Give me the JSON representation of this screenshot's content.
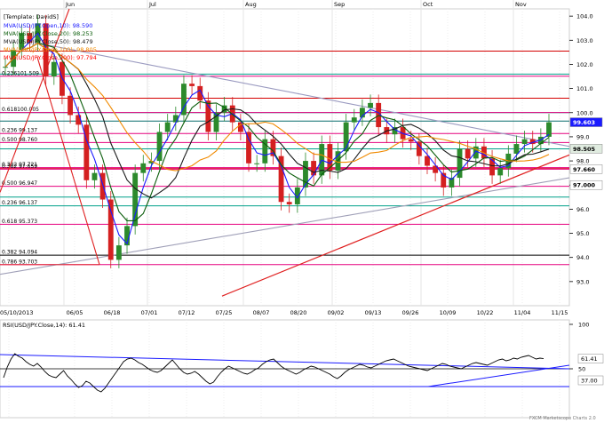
{
  "chart_data": {
    "type": "line",
    "title": "[Template: DavidS]",
    "instrument": "USD/JPY",
    "months": [
      "Jun",
      "Jul",
      "Aug",
      "Sep",
      "Oct",
      "Nov"
    ],
    "legend": [
      {
        "text": "MVA(USD/JPY.Open,10): 98.590",
        "color": "#1a1aff"
      },
      {
        "text": "MVA(USD/JPY.Close,20): 98.253",
        "color": "#0b5d0b"
      },
      {
        "text": "MVA(USD/JPY.Close,50): 98.479",
        "color": "#1a1a1a"
      },
      {
        "text": "MVA(USD/JPY.Close,100): 98.805",
        "color": "#f08a00"
      },
      {
        "text": "MVA(USD/JPY.Close,200): 97.794",
        "color": "#ff0000"
      }
    ],
    "x_tick_labels": [
      "05/10/2013",
      "06/05",
      "06/18",
      "07/01",
      "07/12",
      "07/25",
      "08/07",
      "08/20",
      "09/02",
      "09/13",
      "09/26",
      "10/09",
      "10/22",
      "11/04",
      "11/15"
    ],
    "y_axis": {
      "ylim": [
        92.0,
        104.3
      ],
      "ticks": [
        104.0,
        103.0,
        102.0,
        101.0,
        100.0,
        99.0,
        98.0,
        97.0,
        96.0,
        95.0,
        94.0,
        93.0
      ]
    },
    "price_boxes": [
      {
        "label": "99.603",
        "value": 99.603,
        "bg": "#1a1aff",
        "fg": "#ffffff"
      },
      {
        "label": "98.505",
        "value": 98.505,
        "bg": "#e0ece0",
        "fg": "#000000"
      },
      {
        "label": "97.660",
        "value": 97.66,
        "bg": "#ffffff",
        "fg": "#000000"
      },
      {
        "label": "97.000",
        "value": 97.0,
        "bg": "#ffffff",
        "fg": "#000000"
      }
    ],
    "fib_levels": [
      {
        "label": "0.236101.509",
        "value": 101.509,
        "color": "#e6007e"
      },
      {
        "label": "0.618100.005",
        "value": 100.005,
        "color": "#e6007e"
      },
      {
        "label": "0.236 99.137",
        "value": 99.137,
        "color": "#e6007e"
      },
      {
        "label": "0.500 98.760",
        "value": 98.76,
        "color": "#e6007e"
      },
      {
        "label": "0.382 97.721",
        "value": 97.721,
        "color": "#e6007e"
      },
      {
        "label": "0.382 97.659",
        "value": 97.659,
        "color": "#e6007e"
      },
      {
        "label": "0.500 96.947",
        "value": 96.947,
        "color": "#e6007e"
      },
      {
        "label": "0.236 96.137",
        "value": 96.137,
        "color": "#00a08a"
      },
      {
        "label": "0.618 95.373",
        "value": 95.373,
        "color": "#e6007e"
      },
      {
        "label": "0.382 94.094",
        "value": 94.094,
        "color": "#000000"
      },
      {
        "label": "0.786 93.703",
        "value": 93.703,
        "color": "#e6007e"
      }
    ],
    "horizontal_lines": [
      {
        "value": 102.55,
        "color": "#d40000"
      },
      {
        "value": 101.6,
        "color": "#00a08a"
      },
      {
        "value": 100.6,
        "color": "#d40000"
      },
      {
        "value": 100.0,
        "color": "#00a08a"
      },
      {
        "value": 99.65,
        "color": "#0a6e6e"
      },
      {
        "value": 98.5,
        "color": "#00a08a"
      },
      {
        "value": 97.7,
        "color": "#d40000"
      },
      {
        "value": 96.5,
        "color": "#00a08a"
      }
    ],
    "close_series": [
      {
        "x": "05/10/2013",
        "y": 101.9
      },
      {
        "x": "05/13",
        "y": 102.6
      },
      {
        "x": "05/17",
        "y": 103.3
      },
      {
        "x": "05/21",
        "y": 102.9
      },
      {
        "x": "05/22",
        "y": 103.7
      },
      {
        "x": "05/24",
        "y": 101.5
      },
      {
        "x": "05/28",
        "y": 102.1
      },
      {
        "x": "05/30",
        "y": 100.7
      },
      {
        "x": "06/03",
        "y": 99.9
      },
      {
        "x": "06/05",
        "y": 99.5
      },
      {
        "x": "06/06",
        "y": 97.2
      },
      {
        "x": "06/07",
        "y": 97.5
      },
      {
        "x": "06/11",
        "y": 96.4
      },
      {
        "x": "06/13",
        "y": 93.9
      },
      {
        "x": "06/16",
        "y": 94.5
      },
      {
        "x": "06/18",
        "y": 95.3
      },
      {
        "x": "06/20",
        "y": 97.5
      },
      {
        "x": "06/24",
        "y": 97.9
      },
      {
        "x": "06/26",
        "y": 98.0
      },
      {
        "x": "06/28",
        "y": 99.2
      },
      {
        "x": "07/01",
        "y": 99.6
      },
      {
        "x": "07/03",
        "y": 99.9
      },
      {
        "x": "07/05",
        "y": 101.2
      },
      {
        "x": "07/08",
        "y": 101.1
      },
      {
        "x": "07/10",
        "y": 100.5
      },
      {
        "x": "07/12",
        "y": 99.2
      },
      {
        "x": "07/15",
        "y": 100.0
      },
      {
        "x": "07/18",
        "y": 100.3
      },
      {
        "x": "07/22",
        "y": 99.6
      },
      {
        "x": "07/25",
        "y": 99.2
      },
      {
        "x": "07/29",
        "y": 97.9
      },
      {
        "x": "07/31",
        "y": 97.9
      },
      {
        "x": "08/02",
        "y": 98.9
      },
      {
        "x": "08/05",
        "y": 98.2
      },
      {
        "x": "08/07",
        "y": 96.3
      },
      {
        "x": "08/09",
        "y": 96.2
      },
      {
        "x": "08/12",
        "y": 96.9
      },
      {
        "x": "08/15",
        "y": 98.0
      },
      {
        "x": "08/20",
        "y": 97.4
      },
      {
        "x": "08/22",
        "y": 98.7
      },
      {
        "x": "08/27",
        "y": 97.6
      },
      {
        "x": "08/29",
        "y": 98.4
      },
      {
        "x": "09/02",
        "y": 99.6
      },
      {
        "x": "09/05",
        "y": 99.8
      },
      {
        "x": "09/09",
        "y": 100.2
      },
      {
        "x": "09/11",
        "y": 100.4
      },
      {
        "x": "09/13",
        "y": 99.4
      },
      {
        "x": "09/17",
        "y": 99.1
      },
      {
        "x": "09/19",
        "y": 99.4
      },
      {
        "x": "09/23",
        "y": 98.9
      },
      {
        "x": "09/26",
        "y": 98.8
      },
      {
        "x": "09/30",
        "y": 98.2
      },
      {
        "x": "10/02",
        "y": 97.8
      },
      {
        "x": "10/04",
        "y": 97.5
      },
      {
        "x": "10/07",
        "y": 96.9
      },
      {
        "x": "10/09",
        "y": 97.3
      },
      {
        "x": "10/11",
        "y": 98.5
      },
      {
        "x": "10/15",
        "y": 98.1
      },
      {
        "x": "10/17",
        "y": 98.6
      },
      {
        "x": "10/22",
        "y": 98.1
      },
      {
        "x": "10/24",
        "y": 97.4
      },
      {
        "x": "10/28",
        "y": 97.7
      },
      {
        "x": "10/30",
        "y": 98.3
      },
      {
        "x": "11/01",
        "y": 98.7
      },
      {
        "x": "11/04",
        "y": 98.9
      },
      {
        "x": "11/06",
        "y": 98.7
      },
      {
        "x": "11/08",
        "y": 99.0
      },
      {
        "x": "11/11",
        "y": 99.6
      }
    ],
    "oscillator": {
      "label": "RSI(USD/JPY.Close,14): 61.41",
      "ylim": [
        0,
        100
      ],
      "ticks": [
        {
          "label": "100",
          "value": 100
        },
        {
          "label": "50",
          "value": 50
        }
      ],
      "value_boxes": [
        {
          "label": "61.41",
          "value": 61.4
        },
        {
          "label": "37.00",
          "value": 37.0
        }
      ],
      "values": [
        40,
        52,
        61,
        67,
        64,
        62,
        58,
        55,
        53,
        56,
        52,
        47,
        43,
        41,
        40,
        44,
        48,
        42,
        38,
        33,
        29,
        31,
        36,
        34,
        30,
        26,
        24,
        28,
        34,
        40,
        46,
        52,
        58,
        61,
        62,
        60,
        57,
        55,
        52,
        49,
        47,
        46,
        48,
        52,
        56,
        60,
        55,
        50,
        46,
        44,
        45,
        47,
        44,
        40,
        36,
        33,
        35,
        41,
        46,
        50,
        53,
        51,
        49,
        47,
        45,
        44,
        46,
        49,
        51,
        55,
        58,
        60,
        61,
        57,
        53,
        50,
        48,
        46,
        44,
        46,
        49,
        51,
        53,
        52,
        50,
        48,
        46,
        44,
        41,
        39,
        42,
        46,
        49,
        51,
        53,
        55,
        54,
        52,
        51,
        53,
        55,
        57,
        59,
        60,
        61,
        59,
        57,
        55,
        53,
        52,
        51,
        50,
        49,
        48,
        50,
        52,
        54,
        56,
        55,
        53,
        52,
        51,
        50,
        52,
        54,
        56,
        57,
        56,
        55,
        54,
        56,
        58,
        60,
        61,
        59,
        60,
        62,
        61,
        63,
        64,
        65,
        63,
        61,
        62,
        61.4
      ]
    },
    "footer": "FXCM Marketscope Charts 2.0"
  }
}
